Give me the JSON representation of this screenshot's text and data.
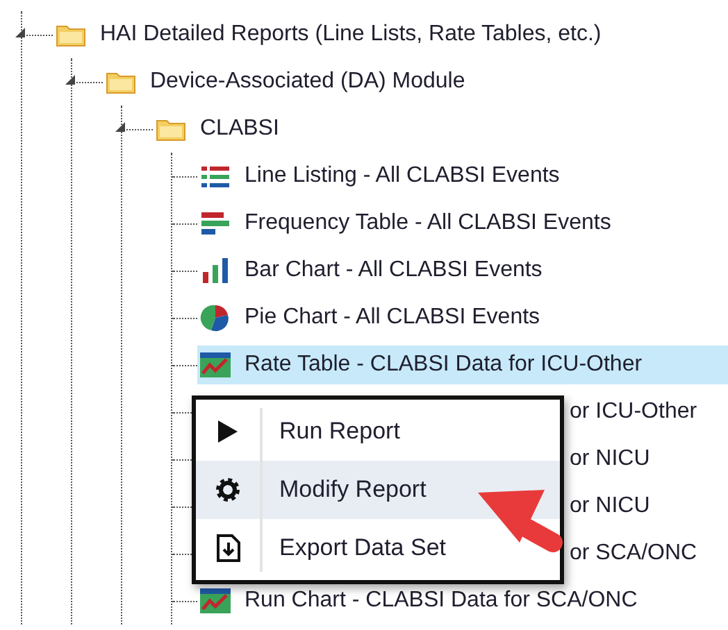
{
  "tree": [
    {
      "label": "HAI Detailed Reports (Line Lists, Rate Tables, etc.)",
      "kind": "folder",
      "expanded": true,
      "selected": false,
      "children": [
        {
          "label": "Device-Associated (DA) Module",
          "kind": "folder",
          "expanded": true,
          "selected": false,
          "children": [
            {
              "label": "CLABSI",
              "kind": "folder",
              "expanded": true,
              "selected": false,
              "children": [
                {
                  "label": "Line Listing - All CLABSI Events",
                  "kind": "list",
                  "selected": false
                },
                {
                  "label": "Frequency Table - All CLABSI Events",
                  "kind": "frequency",
                  "selected": false
                },
                {
                  "label": "Bar Chart - All CLABSI Events",
                  "kind": "bar",
                  "selected": false
                },
                {
                  "label": "Pie Chart - All CLABSI Events",
                  "kind": "pie",
                  "selected": false
                },
                {
                  "label": "Rate Table - CLABSI Data for ICU-Other",
                  "kind": "rate",
                  "selected": true
                },
                {
                  "label": "or ICU-Other",
                  "kind": "covered",
                  "selected": false
                },
                {
                  "label": "or NICU",
                  "kind": "covered",
                  "selected": false
                },
                {
                  "label": "or NICU",
                  "kind": "covered",
                  "selected": false
                },
                {
                  "label": "or SCA/ONC",
                  "kind": "covered",
                  "selected": false
                },
                {
                  "label": "Run Chart - CLABSI Data for SCA/ONC",
                  "kind": "run",
                  "selected": false
                }
              ]
            }
          ]
        }
      ]
    }
  ],
  "context_menu": {
    "items": [
      {
        "label": "Run Report",
        "kind": "run",
        "selected": false
      },
      {
        "label": "Modify Report",
        "kind": "modify",
        "selected": true
      },
      {
        "label": "Export Data Set",
        "kind": "export",
        "selected": false
      }
    ]
  }
}
